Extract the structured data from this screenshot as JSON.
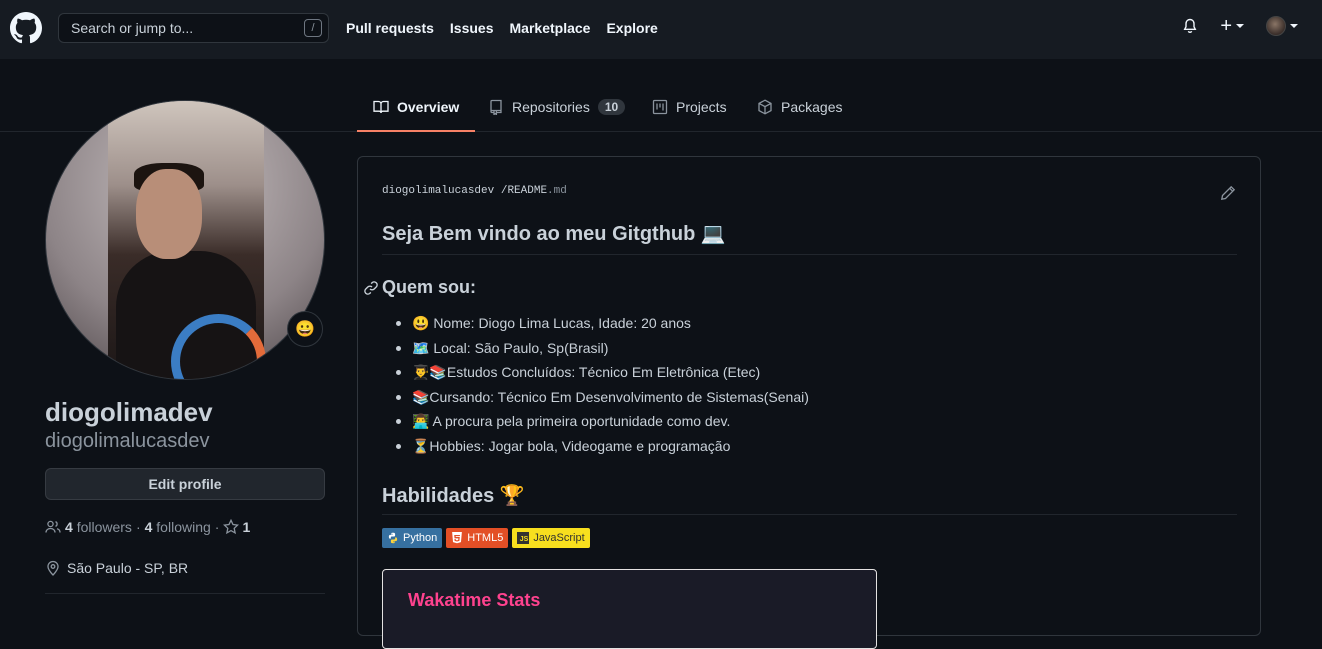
{
  "header": {
    "search_placeholder": "Search or jump to...",
    "search_shortcut": "/",
    "nav": [
      "Pull requests",
      "Issues",
      "Marketplace",
      "Explore"
    ],
    "plus": "+"
  },
  "tabs": [
    {
      "label": "Overview",
      "active": true
    },
    {
      "label": "Repositories",
      "count": "10"
    },
    {
      "label": "Projects"
    },
    {
      "label": "Packages"
    }
  ],
  "profile": {
    "status_emoji": "😀",
    "name": "diogolimadev",
    "login": "diogolimalucasdev",
    "edit_button": "Edit profile",
    "followers_count": "4",
    "followers_label": "followers",
    "following_count": "4",
    "following_label": "following",
    "stars_count": "1",
    "location": "São Paulo - SP, BR"
  },
  "readme": {
    "owner": "diogolimalucasdev",
    "separator": "/",
    "file": "README",
    "ext": ".md",
    "title": "Seja Bem vindo ao meu Gitgthub 💻",
    "who_heading": "Quem sou:",
    "items": [
      "😃 Nome: Diogo Lima Lucas, Idade: 20 anos",
      "🗺️ Local: São Paulo, Sp(Brasil)",
      "👨‍🎓📚Estudos Concluídos: Técnico Em Eletrônica (Etec)",
      "📚Cursando: Técnico Em Desenvolvimento de Sistemas(Senai)",
      "👨‍💻 A procura pela primeira oportunidade como dev.",
      "⏳Hobbies: Jogar bola, Videogame e programação"
    ],
    "skills_heading": "Habilidades 🏆",
    "badges": [
      "Python",
      "HTML5",
      "JavaScript"
    ],
    "wakatime_title": "Wakatime Stats"
  },
  "colors": {
    "accent_tab": "#f78166",
    "python": "#3670a0",
    "html5": "#e34f26",
    "javascript": "#f7df1e",
    "wakatime_title": "#fe428e"
  },
  "icons": [
    "github-logo-icon",
    "bell-icon",
    "plus-icon",
    "book-icon",
    "repo-icon",
    "project-icon",
    "package-icon",
    "people-icon",
    "star-icon",
    "location-icon",
    "pencil-icon",
    "link-icon"
  ]
}
